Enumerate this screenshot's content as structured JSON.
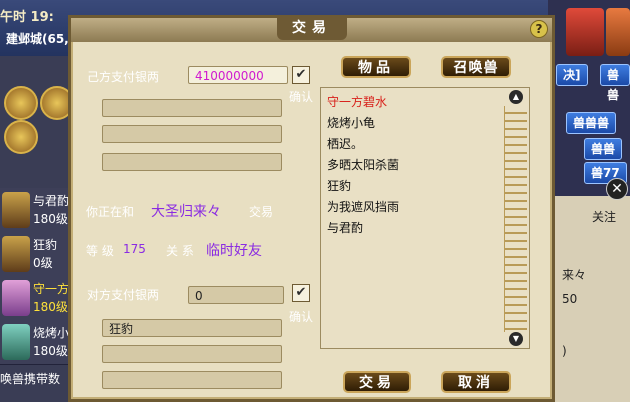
{
  "background": {
    "clock": "午时  19:",
    "city": "建邺城(65,",
    "left_list": [
      {
        "name": "与君酌",
        "level": "180级"
      },
      {
        "name": "狂豹",
        "level": "0级"
      },
      {
        "name": "守一方",
        "level": "180级"
      },
      {
        "name": "烧烤小",
        "level": "180级"
      }
    ],
    "footer_text": "唤兽携带数",
    "right_tabs": [
      "决]",
      "兽兽",
      "兽兽兽",
      "兽兽",
      "兽77"
    ],
    "right_panel": {
      "follow_label": "关注",
      "name_fragment": "来々",
      "number_fragment": "50",
      "paren": ")"
    },
    "close_symbol": "✕"
  },
  "dialog": {
    "title": "交易",
    "help": "?",
    "own_pay_label": "己方支付银两",
    "own_pay_value": "410000000",
    "confirm_label": "确认",
    "own_items": [
      "",
      "",
      ""
    ],
    "trading_with_prefix": "你正在和",
    "partner_name": "大圣归来々",
    "trading_with_suffix": "交易",
    "level_label": "等 级",
    "level_value": "175",
    "relation_label": "关 系",
    "relation_value": "临时好友",
    "other_pay_label": "对方支付银两",
    "other_pay_value": "0",
    "other_items": [
      "狂豹",
      "",
      ""
    ],
    "tab_items": "物品",
    "tab_pets": "召唤兽",
    "pet_list": [
      "守一方碧水",
      "烧烤小龟",
      "栖迟。",
      "多晒太阳杀菌",
      "狂豹",
      "为我遮风挡雨",
      "与君酌"
    ],
    "selected_index": 0,
    "trade_button": "交易",
    "cancel_button": "取消",
    "check_mark": "✔"
  }
}
